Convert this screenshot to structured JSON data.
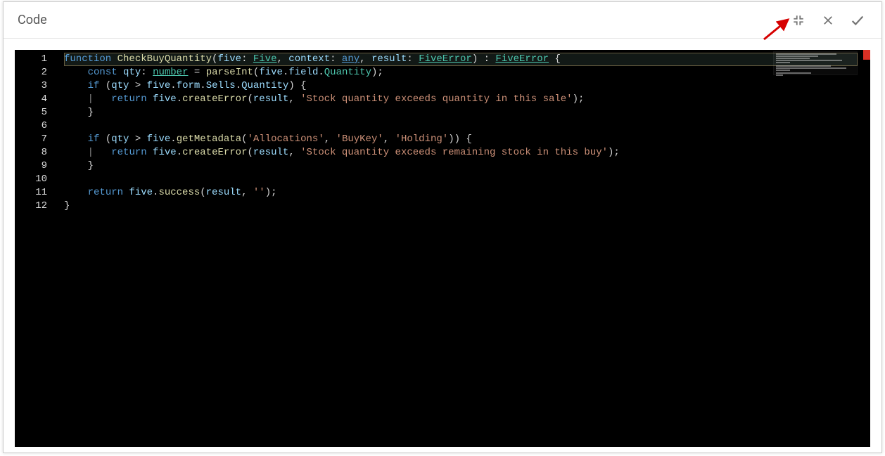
{
  "header": {
    "title": "Code"
  },
  "buttons": {
    "collapse_tooltip": "Collapse",
    "close_tooltip": "Close",
    "confirm_tooltip": "Confirm"
  },
  "editor": {
    "language": "typescript",
    "line_numbers": [
      "1",
      "2",
      "3",
      "4",
      "5",
      "6",
      "7",
      "8",
      "9",
      "10",
      "11",
      "12"
    ],
    "lines": [
      {
        "n": 1,
        "hl": true,
        "tokens": [
          {
            "t": "function ",
            "c": "kw"
          },
          {
            "t": "CheckBuyQuantity",
            "c": "fn"
          },
          {
            "t": "(",
            "c": "pn"
          },
          {
            "t": "five",
            "c": "id"
          },
          {
            "t": ": ",
            "c": "pn"
          },
          {
            "t": "Five",
            "c": "ty"
          },
          {
            "t": ", ",
            "c": "pn"
          },
          {
            "t": "context",
            "c": "id"
          },
          {
            "t": ": ",
            "c": "pn"
          },
          {
            "t": "any",
            "c": "kw ul"
          },
          {
            "t": ", ",
            "c": "pn"
          },
          {
            "t": "result",
            "c": "id"
          },
          {
            "t": ": ",
            "c": "pn"
          },
          {
            "t": "FiveError",
            "c": "ty"
          },
          {
            "t": ") : ",
            "c": "pn"
          },
          {
            "t": "FiveError",
            "c": "ty"
          },
          {
            "t": " {",
            "c": "pn"
          }
        ]
      },
      {
        "n": 2,
        "tokens": [
          {
            "t": "    ",
            "c": "pn"
          },
          {
            "t": "const ",
            "c": "kw"
          },
          {
            "t": "qty",
            "c": "id"
          },
          {
            "t": ": ",
            "c": "pn"
          },
          {
            "t": "number",
            "c": "ty"
          },
          {
            "t": " = ",
            "c": "pn"
          },
          {
            "t": "parseInt",
            "c": "fn"
          },
          {
            "t": "(",
            "c": "pn"
          },
          {
            "t": "five",
            "c": "id"
          },
          {
            "t": ".",
            "c": "pn"
          },
          {
            "t": "field",
            "c": "id"
          },
          {
            "t": ".",
            "c": "pn"
          },
          {
            "t": "Quantity",
            "c": "typ"
          },
          {
            "t": ");",
            "c": "pn"
          }
        ]
      },
      {
        "n": 3,
        "tokens": [
          {
            "t": "    ",
            "c": "pn"
          },
          {
            "t": "if ",
            "c": "kw"
          },
          {
            "t": "(",
            "c": "pn"
          },
          {
            "t": "qty",
            "c": "id"
          },
          {
            "t": " > ",
            "c": "pn"
          },
          {
            "t": "five",
            "c": "id"
          },
          {
            "t": ".",
            "c": "pn"
          },
          {
            "t": "form",
            "c": "id"
          },
          {
            "t": ".",
            "c": "pn"
          },
          {
            "t": "Sells",
            "c": "id"
          },
          {
            "t": ".",
            "c": "pn"
          },
          {
            "t": "Quantity",
            "c": "id"
          },
          {
            "t": ") {",
            "c": "pn"
          }
        ]
      },
      {
        "n": 4,
        "tokens": [
          {
            "t": "    ",
            "c": "pn"
          },
          {
            "t": "|",
            "c": "bar"
          },
          {
            "t": "   ",
            "c": "pn"
          },
          {
            "t": "return ",
            "c": "kw"
          },
          {
            "t": "five",
            "c": "id"
          },
          {
            "t": ".",
            "c": "pn"
          },
          {
            "t": "createError",
            "c": "fn"
          },
          {
            "t": "(",
            "c": "pn"
          },
          {
            "t": "result",
            "c": "id"
          },
          {
            "t": ", ",
            "c": "pn"
          },
          {
            "t": "'Stock quantity exceeds quantity in this sale'",
            "c": "str"
          },
          {
            "t": ");",
            "c": "pn"
          }
        ]
      },
      {
        "n": 5,
        "tokens": [
          {
            "t": "    }",
            "c": "pn"
          }
        ]
      },
      {
        "n": 6,
        "tokens": [
          {
            "t": "",
            "c": "pn"
          }
        ]
      },
      {
        "n": 7,
        "tokens": [
          {
            "t": "    ",
            "c": "pn"
          },
          {
            "t": "if ",
            "c": "kw"
          },
          {
            "t": "(",
            "c": "pn"
          },
          {
            "t": "qty",
            "c": "id"
          },
          {
            "t": " > ",
            "c": "pn"
          },
          {
            "t": "five",
            "c": "id"
          },
          {
            "t": ".",
            "c": "pn"
          },
          {
            "t": "getMetadata",
            "c": "fn"
          },
          {
            "t": "(",
            "c": "pn"
          },
          {
            "t": "'Allocations'",
            "c": "str"
          },
          {
            "t": ", ",
            "c": "pn"
          },
          {
            "t": "'BuyKey'",
            "c": "str"
          },
          {
            "t": ", ",
            "c": "pn"
          },
          {
            "t": "'Holding'",
            "c": "str"
          },
          {
            "t": ")) {",
            "c": "pn"
          }
        ]
      },
      {
        "n": 8,
        "tokens": [
          {
            "t": "    ",
            "c": "pn"
          },
          {
            "t": "|",
            "c": "bar"
          },
          {
            "t": "   ",
            "c": "pn"
          },
          {
            "t": "return ",
            "c": "kw"
          },
          {
            "t": "five",
            "c": "id"
          },
          {
            "t": ".",
            "c": "pn"
          },
          {
            "t": "createError",
            "c": "fn"
          },
          {
            "t": "(",
            "c": "pn"
          },
          {
            "t": "result",
            "c": "id"
          },
          {
            "t": ", ",
            "c": "pn"
          },
          {
            "t": "'Stock quantity exceeds remaining stock in this buy'",
            "c": "str"
          },
          {
            "t": ");",
            "c": "pn"
          }
        ]
      },
      {
        "n": 9,
        "tokens": [
          {
            "t": "    }",
            "c": "pn"
          }
        ]
      },
      {
        "n": 10,
        "tokens": [
          {
            "t": "",
            "c": "pn"
          }
        ]
      },
      {
        "n": 11,
        "tokens": [
          {
            "t": "    ",
            "c": "pn"
          },
          {
            "t": "return ",
            "c": "kw"
          },
          {
            "t": "five",
            "c": "id"
          },
          {
            "t": ".",
            "c": "pn"
          },
          {
            "t": "success",
            "c": "fn"
          },
          {
            "t": "(",
            "c": "pn"
          },
          {
            "t": "result",
            "c": "id"
          },
          {
            "t": ", ",
            "c": "pn"
          },
          {
            "t": "''",
            "c": "str"
          },
          {
            "t": ");",
            "c": "pn"
          }
        ]
      },
      {
        "n": 12,
        "tokens": [
          {
            "t": "}",
            "c": "pn"
          }
        ]
      }
    ]
  }
}
